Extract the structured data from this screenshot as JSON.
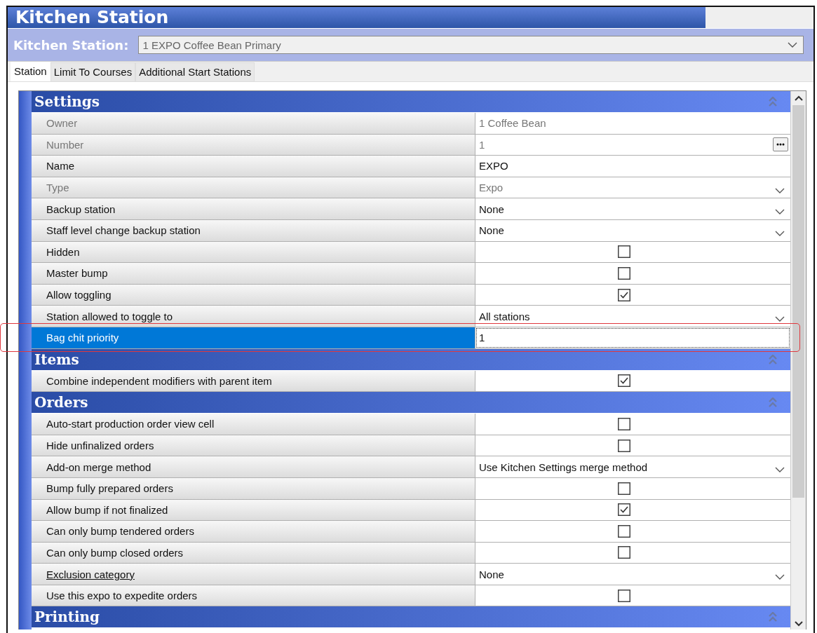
{
  "window": {
    "title": "Kitchen Station"
  },
  "station_selector": {
    "label": "Kitchen Station:",
    "value": "1 EXPO Coffee Bean Primary"
  },
  "tabs": [
    {
      "label": "Station",
      "selected": true
    },
    {
      "label": "Limit To Courses",
      "selected": false
    },
    {
      "label": "Additional Start Stations",
      "selected": false
    }
  ],
  "sections": [
    {
      "title": "Settings",
      "rows": [
        {
          "label": "Owner",
          "kind": "text",
          "value": "1  Coffee Bean",
          "disabled": true,
          "underlined": false,
          "selected": false,
          "outlined": false
        },
        {
          "label": "Number",
          "kind": "ellipsis",
          "value": "1",
          "disabled": true,
          "underlined": false,
          "selected": false,
          "outlined": false
        },
        {
          "label": "Name",
          "kind": "text",
          "value": "EXPO",
          "disabled": false,
          "underlined": false,
          "selected": false,
          "outlined": false
        },
        {
          "label": "Type",
          "kind": "dropdown",
          "value": "Expo",
          "disabled": true,
          "underlined": false,
          "selected": false,
          "outlined": false
        },
        {
          "label": "Backup station",
          "kind": "dropdown",
          "value": "None",
          "disabled": false,
          "underlined": false,
          "selected": false,
          "outlined": false
        },
        {
          "label": "Staff level change backup station",
          "kind": "dropdown",
          "value": "None",
          "disabled": false,
          "underlined": false,
          "selected": false,
          "outlined": false
        },
        {
          "label": "Hidden",
          "kind": "checkbox",
          "checked": false,
          "disabled": false,
          "underlined": false,
          "selected": false,
          "outlined": false
        },
        {
          "label": "Master bump",
          "kind": "checkbox",
          "checked": false,
          "disabled": false,
          "underlined": false,
          "selected": false,
          "outlined": false
        },
        {
          "label": "Allow toggling",
          "kind": "checkbox",
          "checked": true,
          "disabled": false,
          "underlined": false,
          "selected": false,
          "outlined": false
        },
        {
          "label": "Station allowed to toggle to",
          "kind": "dropdown",
          "value": "All stations",
          "disabled": false,
          "underlined": false,
          "selected": false,
          "outlined": false
        },
        {
          "label": "Bag chit priority",
          "kind": "text",
          "value": "1",
          "disabled": false,
          "underlined": false,
          "selected": true,
          "outlined": true
        }
      ]
    },
    {
      "title": "Items",
      "rows": [
        {
          "label": "Combine independent modifiers with parent item",
          "kind": "checkbox",
          "checked": true,
          "disabled": false,
          "underlined": false,
          "selected": false,
          "outlined": false
        }
      ]
    },
    {
      "title": "Orders",
      "rows": [
        {
          "label": "Auto-start production order view cell",
          "kind": "checkbox",
          "checked": false,
          "disabled": false,
          "underlined": false,
          "selected": false,
          "outlined": false
        },
        {
          "label": "Hide unfinalized orders",
          "kind": "checkbox",
          "checked": false,
          "disabled": false,
          "underlined": false,
          "selected": false,
          "outlined": false
        },
        {
          "label": "Add-on merge method",
          "kind": "dropdown",
          "value": "Use Kitchen Settings merge method",
          "disabled": false,
          "underlined": false,
          "selected": false,
          "outlined": false
        },
        {
          "label": "Bump fully prepared orders",
          "kind": "checkbox",
          "checked": false,
          "disabled": false,
          "underlined": false,
          "selected": false,
          "outlined": false
        },
        {
          "label": "Allow bump if not finalized",
          "kind": "checkbox",
          "checked": true,
          "disabled": false,
          "underlined": false,
          "selected": false,
          "outlined": false
        },
        {
          "label": "Can only bump tendered orders",
          "kind": "checkbox",
          "checked": false,
          "disabled": false,
          "underlined": false,
          "selected": false,
          "outlined": false
        },
        {
          "label": "Can only bump closed orders",
          "kind": "checkbox",
          "checked": false,
          "disabled": false,
          "underlined": false,
          "selected": false,
          "outlined": false
        },
        {
          "label": "Exclusion category",
          "kind": "dropdown",
          "value": "None",
          "disabled": false,
          "underlined": true,
          "selected": false,
          "outlined": false
        },
        {
          "label": "Use this expo to expedite orders",
          "kind": "checkbox",
          "checked": false,
          "disabled": false,
          "underlined": false,
          "selected": false,
          "outlined": false
        }
      ]
    },
    {
      "title": "Printing"
    }
  ]
}
